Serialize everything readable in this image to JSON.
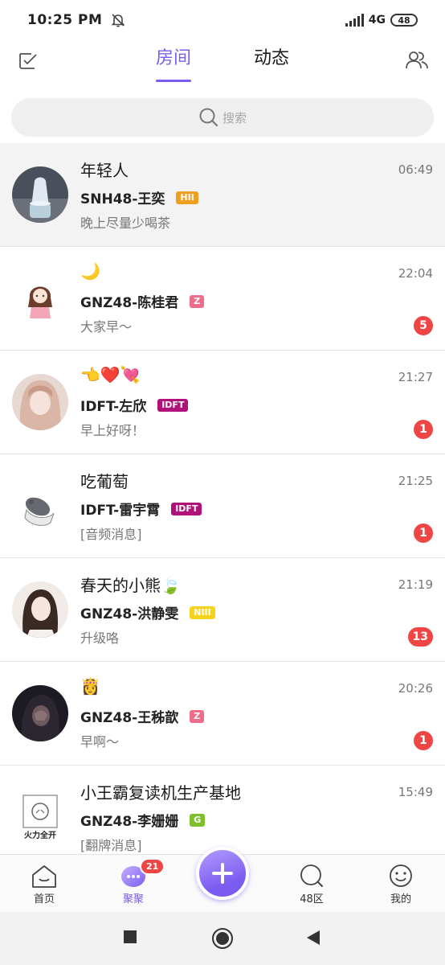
{
  "status_bar": {
    "time": "10:25 PM",
    "network": "4G",
    "battery": "48"
  },
  "header": {
    "tabs": [
      {
        "label": "房间",
        "active": true
      },
      {
        "label": "动态",
        "active": false
      }
    ]
  },
  "search": {
    "placeholder": "搜索"
  },
  "rooms": [
    {
      "title": "年轻人",
      "member": "SNH48-王奕",
      "team": "HII",
      "team_color": "#f0a020",
      "message": "晚上尽量少喝茶",
      "time": "06:49",
      "unread": ""
    },
    {
      "title": "🌙",
      "member": "GNZ48-陈桂君",
      "team": "Z",
      "team_color": "#ef6d8a",
      "message": "大家早～",
      "time": "22:04",
      "unread": "5"
    },
    {
      "title": "👈❤️💘",
      "member": "IDFT-左欣",
      "team": "IDFT",
      "team_color": "#b0127a",
      "message": "早上好呀！",
      "time": "21:27",
      "unread": "1"
    },
    {
      "title": "吃葡萄",
      "member": "IDFT-雷宇霄",
      "team": "IDFT",
      "team_color": "#b0127a",
      "message": "[音频消息]",
      "time": "21:25",
      "unread": "1"
    },
    {
      "title": "春天的小熊🍃",
      "member": "GNZ48-洪静雯",
      "team": "NIII",
      "team_color": "#f5d21c",
      "message": "升级咯",
      "time": "21:19",
      "unread": "13"
    },
    {
      "title": "👸",
      "member": "GNZ48-王秭歆",
      "team": "Z",
      "team_color": "#ef6d8a",
      "message": "早啊～",
      "time": "20:26",
      "unread": "1"
    },
    {
      "title": "小王霸复读机生产基地",
      "member": "GNZ48-李姗姗",
      "team": "G",
      "team_color": "#7dc02b",
      "message": "[翻牌消息]",
      "time": "15:49",
      "unread": "",
      "avatar_text": "火力全开"
    }
  ],
  "bottom_nav": {
    "home": "首页",
    "gather": "聚聚",
    "gather_badge": "21",
    "district": "48区",
    "mine": "我的"
  },
  "colors": {
    "accent": "#7a5cf0",
    "badge": "#f04545"
  }
}
